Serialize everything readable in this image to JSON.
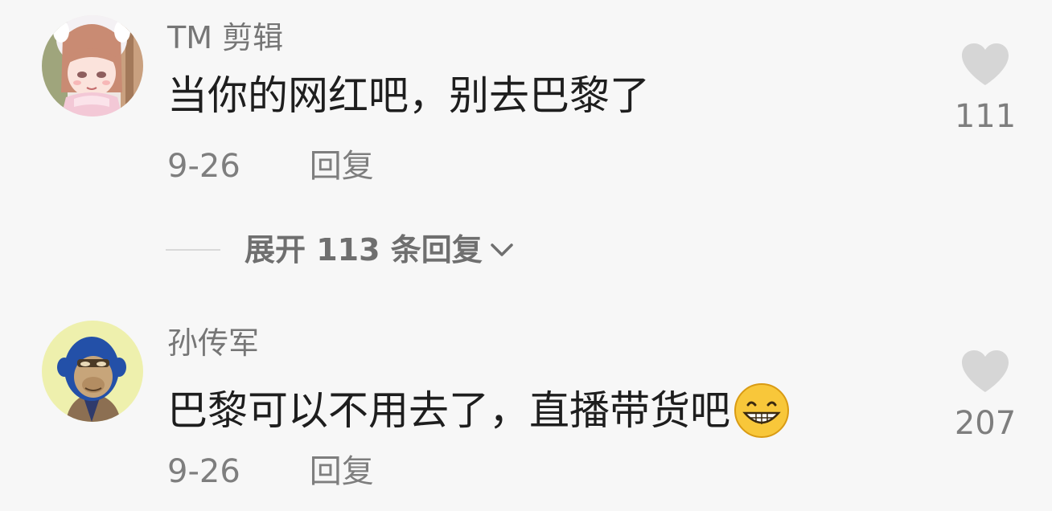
{
  "comments": [
    {
      "username": "TM 剪辑",
      "text": "当你的网红吧，别去巴黎了",
      "date": "9-26",
      "reply_label": "回复",
      "likes": "111",
      "avatar": "anime-girl-avatar"
    },
    {
      "username": "孙传军",
      "text": "巴黎可以不用去了，直播带货吧",
      "date": "9-26",
      "reply_label": "回复",
      "likes": "207",
      "avatar": "ape-avatar",
      "emoji": "grinning-face-emoji"
    }
  ],
  "expand_replies": {
    "label": "展开 113 条回复"
  },
  "colors": {
    "background": "#f7f7f7",
    "comment_text": "#1e1e1e",
    "secondary_text": "#7e7e7e",
    "heart": "#d6d6d6"
  }
}
